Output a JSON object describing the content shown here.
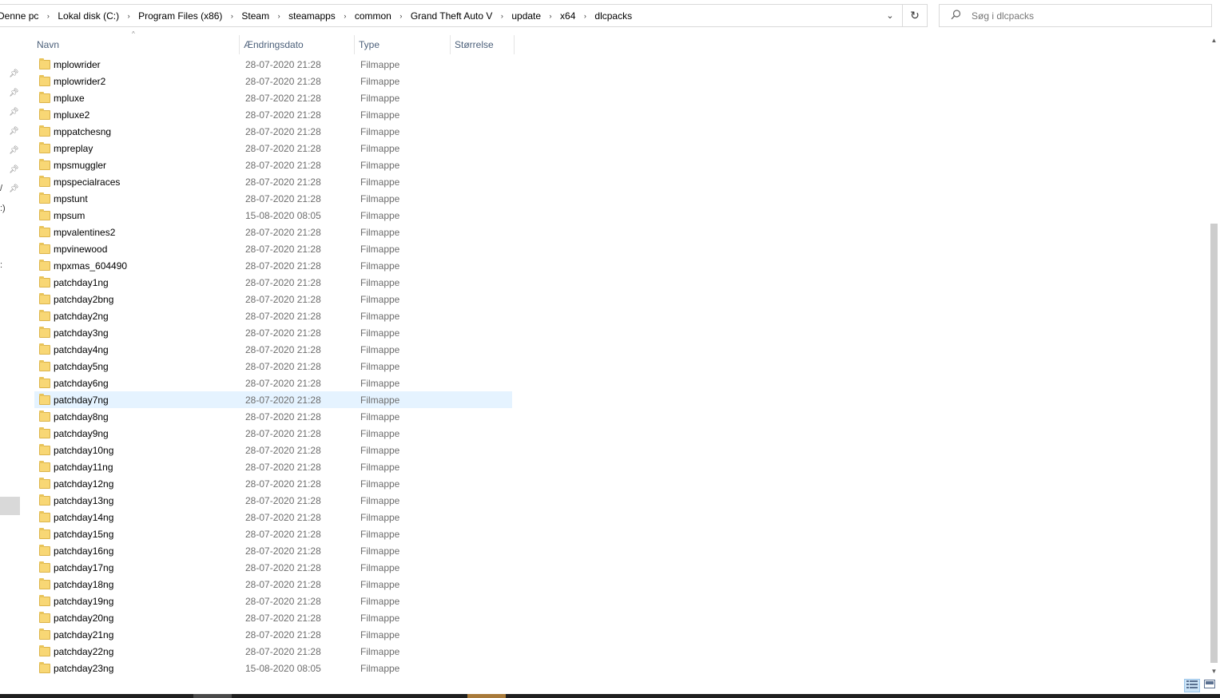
{
  "address_bar": {
    "crumbs": [
      "Denne pc",
      "Lokal disk (C:)",
      "Program Files (x86)",
      "Steam",
      "steamapps",
      "common",
      "Grand Theft Auto V",
      "update",
      "x64",
      "dlcpacks"
    ],
    "separator": "›",
    "dropdown_glyph": "⌄",
    "refresh_glyph": "↻"
  },
  "search": {
    "icon": "search-icon",
    "placeholder": "Søg i dlcpacks"
  },
  "nav_pane": {
    "fragments": [
      "/",
      ":)",
      ":"
    ]
  },
  "columns": {
    "name": "Navn",
    "date": "Ændringsdato",
    "type": "Type",
    "size": "Størrelse"
  },
  "files": [
    {
      "name": "mplowrider",
      "date": "28-07-2020 21:28",
      "type": "Filmappe"
    },
    {
      "name": "mplowrider2",
      "date": "28-07-2020 21:28",
      "type": "Filmappe"
    },
    {
      "name": "mpluxe",
      "date": "28-07-2020 21:28",
      "type": "Filmappe"
    },
    {
      "name": "mpluxe2",
      "date": "28-07-2020 21:28",
      "type": "Filmappe"
    },
    {
      "name": "mppatchesng",
      "date": "28-07-2020 21:28",
      "type": "Filmappe"
    },
    {
      "name": "mpreplay",
      "date": "28-07-2020 21:28",
      "type": "Filmappe"
    },
    {
      "name": "mpsmuggler",
      "date": "28-07-2020 21:28",
      "type": "Filmappe"
    },
    {
      "name": "mpspecialraces",
      "date": "28-07-2020 21:28",
      "type": "Filmappe"
    },
    {
      "name": "mpstunt",
      "date": "28-07-2020 21:28",
      "type": "Filmappe"
    },
    {
      "name": "mpsum",
      "date": "15-08-2020 08:05",
      "type": "Filmappe"
    },
    {
      "name": "mpvalentines2",
      "date": "28-07-2020 21:28",
      "type": "Filmappe"
    },
    {
      "name": "mpvinewood",
      "date": "28-07-2020 21:28",
      "type": "Filmappe"
    },
    {
      "name": "mpxmas_604490",
      "date": "28-07-2020 21:28",
      "type": "Filmappe"
    },
    {
      "name": "patchday1ng",
      "date": "28-07-2020 21:28",
      "type": "Filmappe"
    },
    {
      "name": "patchday2bng",
      "date": "28-07-2020 21:28",
      "type": "Filmappe"
    },
    {
      "name": "patchday2ng",
      "date": "28-07-2020 21:28",
      "type": "Filmappe"
    },
    {
      "name": "patchday3ng",
      "date": "28-07-2020 21:28",
      "type": "Filmappe"
    },
    {
      "name": "patchday4ng",
      "date": "28-07-2020 21:28",
      "type": "Filmappe"
    },
    {
      "name": "patchday5ng",
      "date": "28-07-2020 21:28",
      "type": "Filmappe"
    },
    {
      "name": "patchday6ng",
      "date": "28-07-2020 21:28",
      "type": "Filmappe"
    },
    {
      "name": "patchday7ng",
      "date": "28-07-2020 21:28",
      "type": "Filmappe",
      "hover": true
    },
    {
      "name": "patchday8ng",
      "date": "28-07-2020 21:28",
      "type": "Filmappe"
    },
    {
      "name": "patchday9ng",
      "date": "28-07-2020 21:28",
      "type": "Filmappe"
    },
    {
      "name": "patchday10ng",
      "date": "28-07-2020 21:28",
      "type": "Filmappe"
    },
    {
      "name": "patchday11ng",
      "date": "28-07-2020 21:28",
      "type": "Filmappe"
    },
    {
      "name": "patchday12ng",
      "date": "28-07-2020 21:28",
      "type": "Filmappe"
    },
    {
      "name": "patchday13ng",
      "date": "28-07-2020 21:28",
      "type": "Filmappe"
    },
    {
      "name": "patchday14ng",
      "date": "28-07-2020 21:28",
      "type": "Filmappe"
    },
    {
      "name": "patchday15ng",
      "date": "28-07-2020 21:28",
      "type": "Filmappe"
    },
    {
      "name": "patchday16ng",
      "date": "28-07-2020 21:28",
      "type": "Filmappe"
    },
    {
      "name": "patchday17ng",
      "date": "28-07-2020 21:28",
      "type": "Filmappe"
    },
    {
      "name": "patchday18ng",
      "date": "28-07-2020 21:28",
      "type": "Filmappe"
    },
    {
      "name": "patchday19ng",
      "date": "28-07-2020 21:28",
      "type": "Filmappe"
    },
    {
      "name": "patchday20ng",
      "date": "28-07-2020 21:28",
      "type": "Filmappe"
    },
    {
      "name": "patchday21ng",
      "date": "28-07-2020 21:28",
      "type": "Filmappe"
    },
    {
      "name": "patchday22ng",
      "date": "28-07-2020 21:28",
      "type": "Filmappe"
    },
    {
      "name": "patchday23ng",
      "date": "15-08-2020 08:05",
      "type": "Filmappe"
    }
  ],
  "icons": {
    "folder": "folder-icon",
    "pin": "pin-icon",
    "scroll_up": "▲",
    "scroll_down": "▼",
    "view_details": "details-view-icon",
    "view_tiles": "large-icons-view-icon"
  },
  "colors": {
    "folder": "#f8d775",
    "hover_row": "#e5f3ff",
    "header_text": "#4c607a",
    "selected_view": "#cce4f7"
  }
}
